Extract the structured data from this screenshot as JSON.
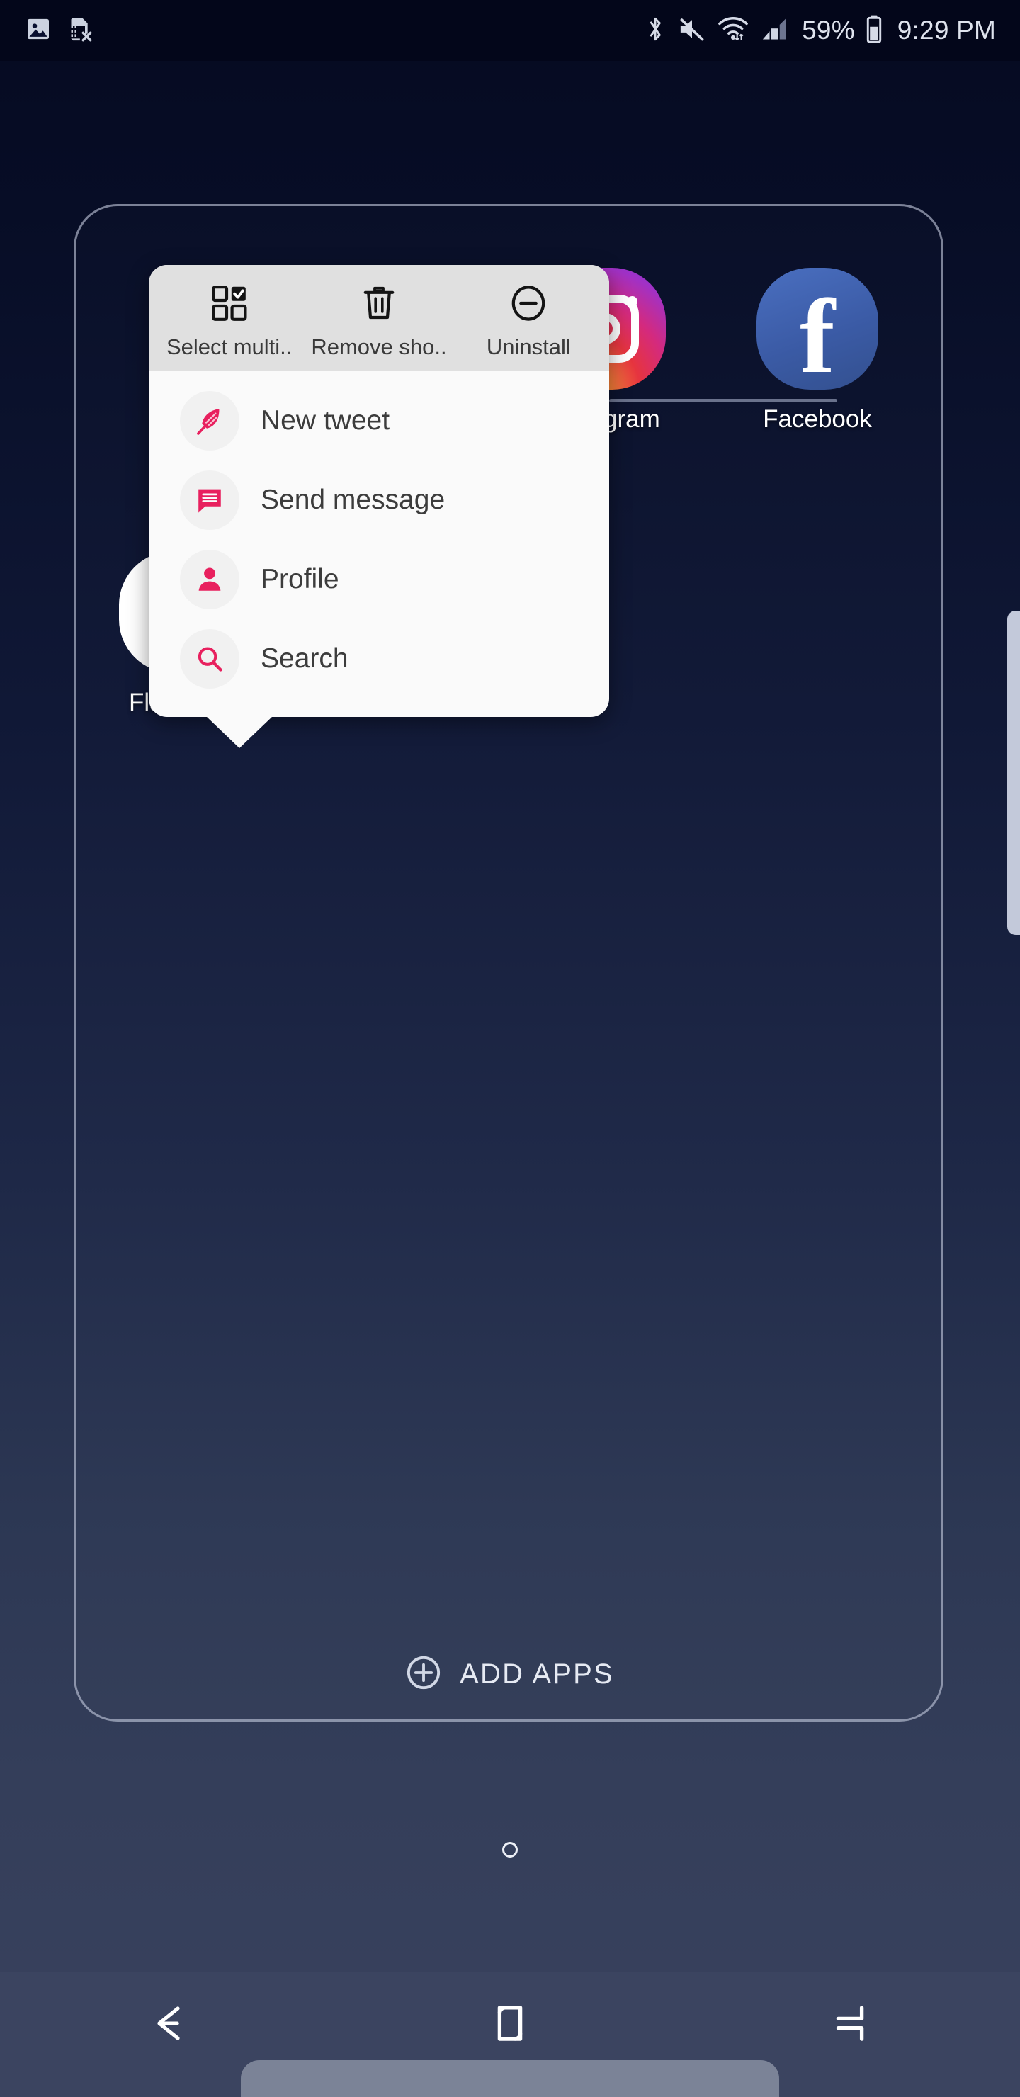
{
  "status_bar": {
    "left_icons": [
      "image-icon",
      "sim-card-off-icon"
    ],
    "right_icons": [
      "bluetooth-icon",
      "volume-mute-icon",
      "wifi-icon",
      "signal-bars-icon",
      "battery-icon"
    ],
    "battery_percent": "59%",
    "clock": "9:29 PM"
  },
  "folder": {
    "apps": [
      {
        "label": "Instagram",
        "icon": "instagram-icon"
      },
      {
        "label": "Facebook",
        "icon": "facebook-icon"
      },
      {
        "label": "Flamingo",
        "icon": "flamingo-icon"
      }
    ],
    "add_apps": {
      "label": "ADD APPS",
      "icon": "plus-circle-icon"
    }
  },
  "popup": {
    "actions": [
      {
        "label": "Select multi..",
        "icon": "select-multiple-icon"
      },
      {
        "label": "Remove sho..",
        "icon": "trash-icon"
      },
      {
        "label": "Uninstall",
        "icon": "minus-circle-icon"
      }
    ],
    "shortcuts": [
      {
        "label": "New tweet",
        "icon": "feather-icon"
      },
      {
        "label": "Send message",
        "icon": "message-icon"
      },
      {
        "label": "Profile",
        "icon": "person-icon"
      },
      {
        "label": "Search",
        "icon": "search-icon"
      }
    ]
  },
  "nav_bar": {
    "buttons": [
      {
        "name": "back",
        "icon": "back-arrow-icon"
      },
      {
        "name": "home",
        "icon": "home-square-icon"
      },
      {
        "name": "recents",
        "icon": "recents-icon"
      }
    ]
  },
  "page_indicator": {
    "pages": 1,
    "current": 1
  },
  "colors": {
    "accent_pink": "#e8205e",
    "facebook_blue": "#3b5ba6",
    "notification_red": "#fb5138",
    "popup_bg": "#fafafa",
    "popup_action_bg": "#e0e0e0",
    "nav_bar_bg": "#3b4460"
  }
}
